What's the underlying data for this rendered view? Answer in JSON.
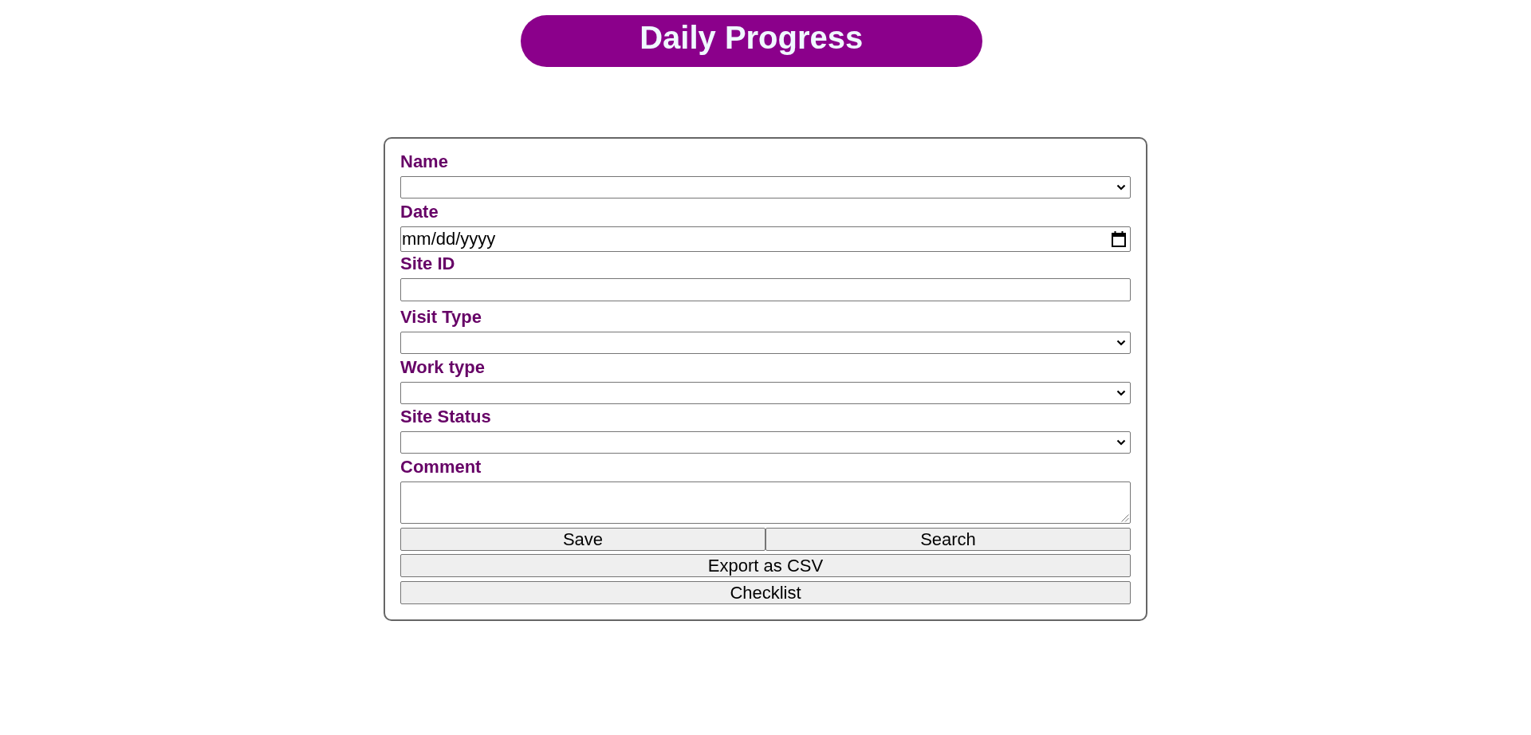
{
  "header": {
    "title": "Daily Progress"
  },
  "form": {
    "fields": [
      {
        "label": "Name",
        "kind": "select"
      },
      {
        "label": "Date",
        "kind": "date",
        "placeholder": "mm/dd/yyyy"
      },
      {
        "label": "Site ID",
        "kind": "text"
      },
      {
        "label": "Visit Type",
        "kind": "select"
      },
      {
        "label": "Work type",
        "kind": "select"
      },
      {
        "label": "Site Status",
        "kind": "select"
      },
      {
        "label": "Comment",
        "kind": "textarea"
      }
    ],
    "button_rows": [
      {
        "buttons": [
          {
            "label": "Save"
          },
          {
            "label": "Search"
          }
        ]
      },
      {
        "buttons": [
          {
            "label": "Export as CSV"
          }
        ]
      },
      {
        "buttons": [
          {
            "label": "Checklist"
          }
        ]
      }
    ]
  }
}
